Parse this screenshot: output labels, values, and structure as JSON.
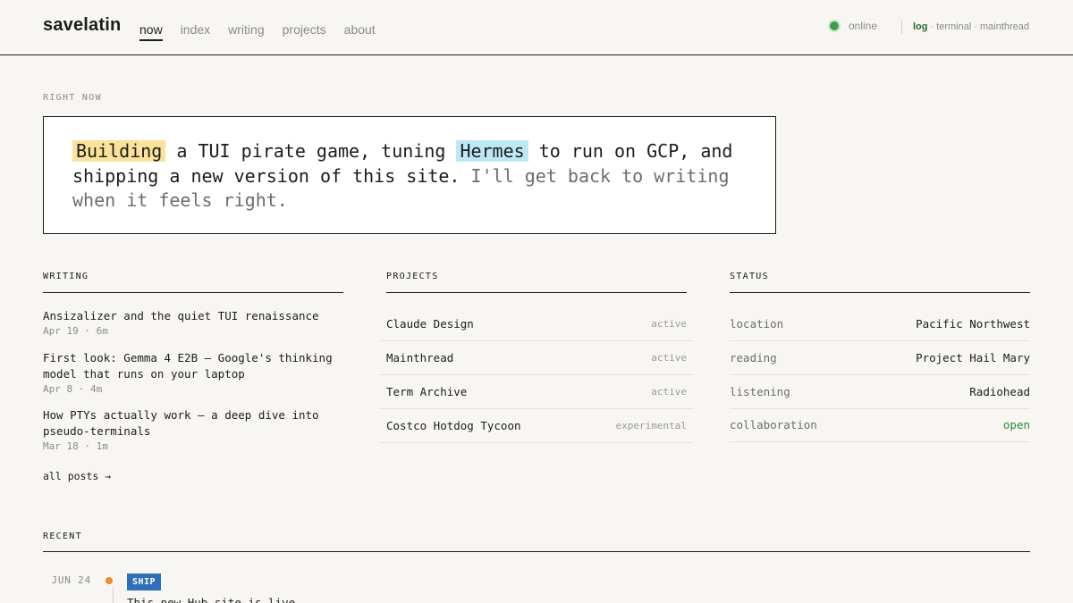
{
  "header": {
    "brand": "savelatin",
    "nav": [
      "now",
      "index",
      "writing",
      "projects",
      "about"
    ],
    "status": "online",
    "links": [
      "log",
      "terminal",
      "mainthread"
    ],
    "link_sep": "·"
  },
  "now": {
    "label": "RIGHT NOW",
    "hl1": "Building",
    "t1": " a TUI pirate game, tuning ",
    "hl2": "Hermes",
    "t2": " to run on GCP, and shipping a new version of this site. ",
    "muted": "I'll get back to writing when it feels right."
  },
  "writing": {
    "label": "WRITING",
    "posts": [
      {
        "title": "Ansizalizer and the quiet TUI renaissance",
        "meta": "Apr 19 · 6m"
      },
      {
        "title": "First look: Gemma 4 E2B — Google's thinking model that runs on your laptop",
        "meta": "Apr 8 · 4m"
      },
      {
        "title": "How PTYs actually work — a deep dive into pseudo-terminals",
        "meta": "Mar 18 · 1m"
      }
    ],
    "all_posts": "all posts →"
  },
  "projects": {
    "label": "PROJECTS",
    "items": [
      {
        "name": "Claude Design",
        "status": "active"
      },
      {
        "name": "Mainthread",
        "status": "active"
      },
      {
        "name": "Term Archive",
        "status": "active"
      },
      {
        "name": "Costco Hotdog Tycoon",
        "status": "experimental"
      }
    ]
  },
  "status": {
    "label": "STATUS",
    "items": [
      {
        "key": "location",
        "value": "Pacific Northwest"
      },
      {
        "key": "reading",
        "value": "Project Hail Mary"
      },
      {
        "key": "listening",
        "value": "Radiohead"
      },
      {
        "key": "collaboration",
        "value": "open"
      }
    ]
  },
  "recent": {
    "label": "RECENT",
    "items": [
      {
        "date": "JUN 24",
        "tag": "SHIP",
        "text": "This new Hub site is live"
      }
    ]
  },
  "colors": {
    "online": "#3aa14a",
    "highlight_yellow": "#fbe29a",
    "highlight_blue": "#bde9f7",
    "ship_tag": "#2d6fb8",
    "timeline_dot": "#e98a2f",
    "open_status": "#2a8a3a"
  }
}
